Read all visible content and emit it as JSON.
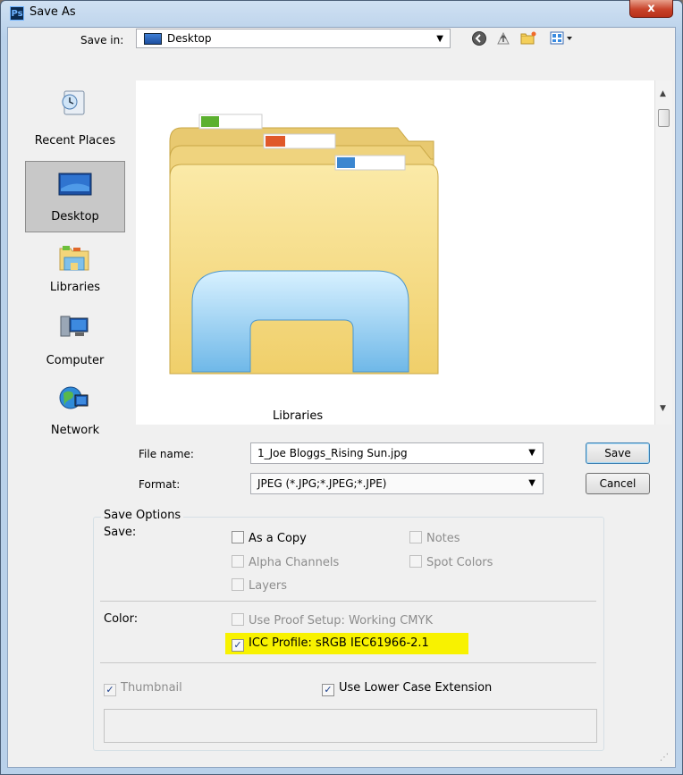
{
  "window": {
    "title": "Save As",
    "app_icon_text": "Ps",
    "close_glyph": "x"
  },
  "save_in": {
    "label": "Save in:",
    "value": "Desktop"
  },
  "toolbar": {
    "icons": [
      "back-icon",
      "up-folder-icon",
      "new-folder-icon",
      "view-menu-icon"
    ]
  },
  "places": [
    {
      "label": "Recent Places",
      "icon": "recent-places-icon"
    },
    {
      "label": "Desktop",
      "icon": "desktop-icon",
      "selected": true
    },
    {
      "label": "Libraries",
      "icon": "libraries-icon"
    },
    {
      "label": "Computer",
      "icon": "computer-icon"
    },
    {
      "label": "Network",
      "icon": "network-icon"
    }
  ],
  "browse": {
    "items": [
      {
        "label": "Libraries",
        "icon": "libraries-folder-icon"
      }
    ]
  },
  "file_name": {
    "label": "File name:",
    "value": "1_Joe Bloggs_Rising Sun.jpg"
  },
  "format": {
    "label": "Format:",
    "value": "JPEG (*.JPG;*.JPEG;*.JPE)"
  },
  "buttons": {
    "save": "Save",
    "cancel": "Cancel"
  },
  "save_options": {
    "title": "Save Options",
    "save_label": "Save:",
    "as_copy": {
      "label": "As a Copy",
      "checked": false,
      "enabled": true
    },
    "notes": {
      "label": "Notes",
      "checked": false,
      "enabled": false
    },
    "alpha_channels": {
      "label": "Alpha Channels",
      "checked": false,
      "enabled": false
    },
    "spot_colors": {
      "label": "Spot Colors",
      "checked": false,
      "enabled": false
    },
    "layers": {
      "label": "Layers",
      "checked": false,
      "enabled": false
    },
    "color_label": "Color:",
    "proof_setup": {
      "label": "Use Proof Setup:  Working CMYK",
      "checked": false,
      "enabled": false
    },
    "icc_profile": {
      "label": "ICC Profile:  sRGB IEC61966-2.1",
      "checked": true,
      "enabled": true,
      "highlight": "#f8f200"
    }
  },
  "thumbnail": {
    "label": "Thumbnail",
    "checked": true,
    "enabled": false
  },
  "lower_case": {
    "label": "Use Lower Case Extension",
    "checked": true,
    "enabled": true
  },
  "check_mark": "✓",
  "colors": {
    "title_bar": "#b9d1ea",
    "dialog_bg": "#f0f0f0",
    "close_button": "#c8432a",
    "highlight": "#f8f200"
  }
}
